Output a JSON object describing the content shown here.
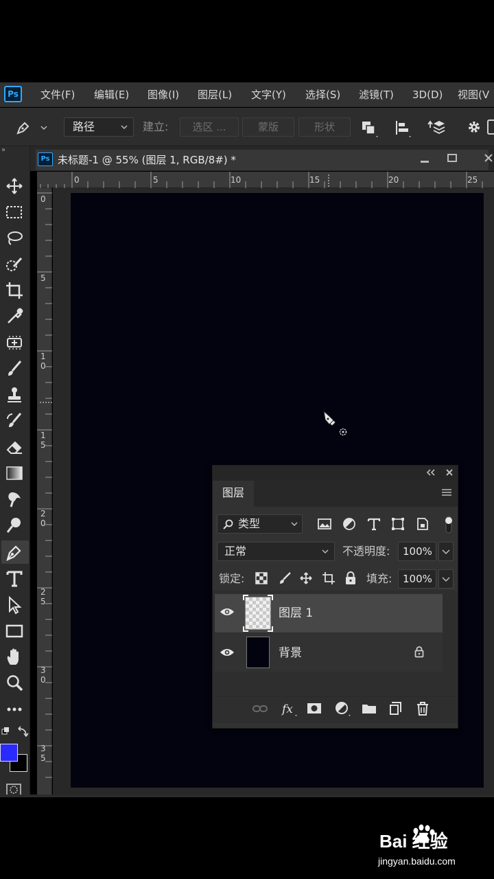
{
  "app": {
    "logo": "Ps",
    "menu": [
      "文件(F)",
      "编辑(E)",
      "图像(I)",
      "图层(L)",
      "文字(Y)",
      "选择(S)",
      "滤镜(T)",
      "3D(D)",
      "视图(V"
    ]
  },
  "options_bar": {
    "mode": "路径",
    "make_label": "建立:",
    "selection_btn": "选区 ...",
    "mask_btn": "蒙版",
    "shape_btn": "形状"
  },
  "document": {
    "tab_logo": "Ps",
    "title": "未标题-1 @ 55% (图层 1, RGB/8#) *",
    "canvas_color": "#03030f"
  },
  "rulers": {
    "horizontal": [
      "0",
      "5",
      "10",
      "15",
      "20",
      "25"
    ],
    "vertical": [
      "0",
      "5",
      "10",
      "15",
      "20",
      "25",
      "30",
      "35"
    ]
  },
  "colors": {
    "foreground": "#2a2aff",
    "background": "#000000",
    "accent": "#31a8ff"
  },
  "layers_panel": {
    "tab": "图层",
    "filter_kind": "类型",
    "blend_mode": "正常",
    "opacity_label": "不透明度:",
    "opacity_value": "100%",
    "lock_label": "锁定:",
    "fill_label": "填充:",
    "fill_value": "100%",
    "layers": [
      {
        "name": "图层 1",
        "selected": true,
        "locked": false
      },
      {
        "name": "背景",
        "selected": false,
        "locked": true
      }
    ]
  },
  "watermark": {
    "brand": "Bai 经验",
    "url": "jingyan.baidu.com"
  }
}
